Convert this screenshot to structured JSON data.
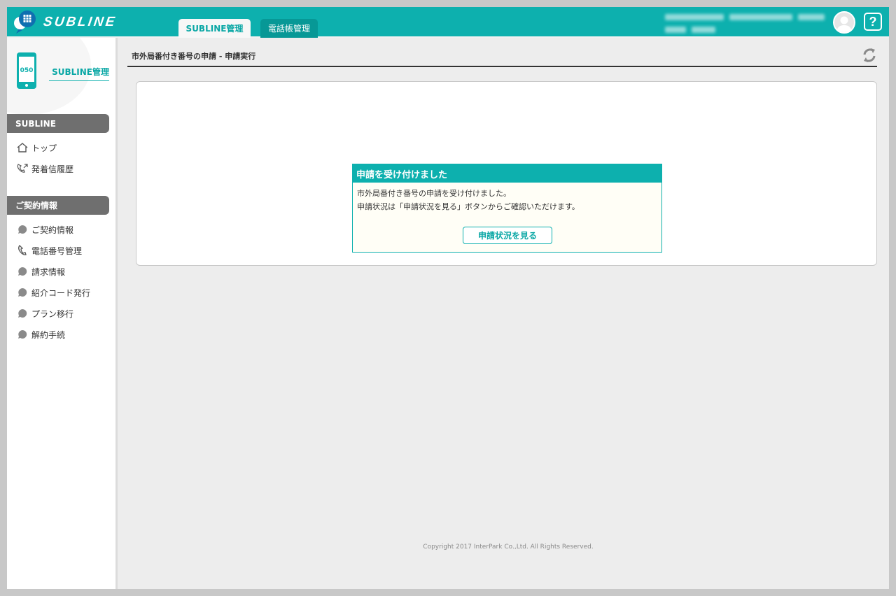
{
  "header": {
    "logo_text": "SUBLINE",
    "tabs": [
      {
        "label": "SUBLINE管理",
        "active": true
      },
      {
        "label": "電話帳管理",
        "active": false
      }
    ],
    "help_label": "?"
  },
  "sidebar": {
    "phone_number_label": "050",
    "title": "SUBLINE管理",
    "sections": [
      {
        "heading": "SUBLINE",
        "items": [
          {
            "label": "トップ",
            "icon": "home-icon"
          },
          {
            "label": "発着信履歴",
            "icon": "call-history-icon"
          }
        ]
      },
      {
        "heading": "ご契約情報",
        "items": [
          {
            "label": "ご契約情報",
            "icon": "bullet-icon"
          },
          {
            "label": "電話番号管理",
            "icon": "phone-icon"
          },
          {
            "label": "請求情報",
            "icon": "bullet-icon"
          },
          {
            "label": "紹介コード発行",
            "icon": "bullet-icon"
          },
          {
            "label": "プラン移行",
            "icon": "bullet-icon"
          },
          {
            "label": "解約手続",
            "icon": "bullet-icon"
          }
        ]
      }
    ]
  },
  "main": {
    "page_title": "市外局番付き番号の申請 - 申請実行",
    "dialog": {
      "title": "申請を受け付けました",
      "line1": "市外局番付き番号の申請を受け付けました。",
      "line2": "申請状況は「申請状況を見る」ボタンからご確認いただけます。",
      "button_label": "申請状況を見る"
    }
  },
  "footer": {
    "copyright": "Copyright 2017 InterPark Co.,Ltd. All Rights Reserved."
  },
  "colors": {
    "brand": "#0db0ae",
    "section_heading": "#6f6f6f",
    "background": "#ededed"
  }
}
